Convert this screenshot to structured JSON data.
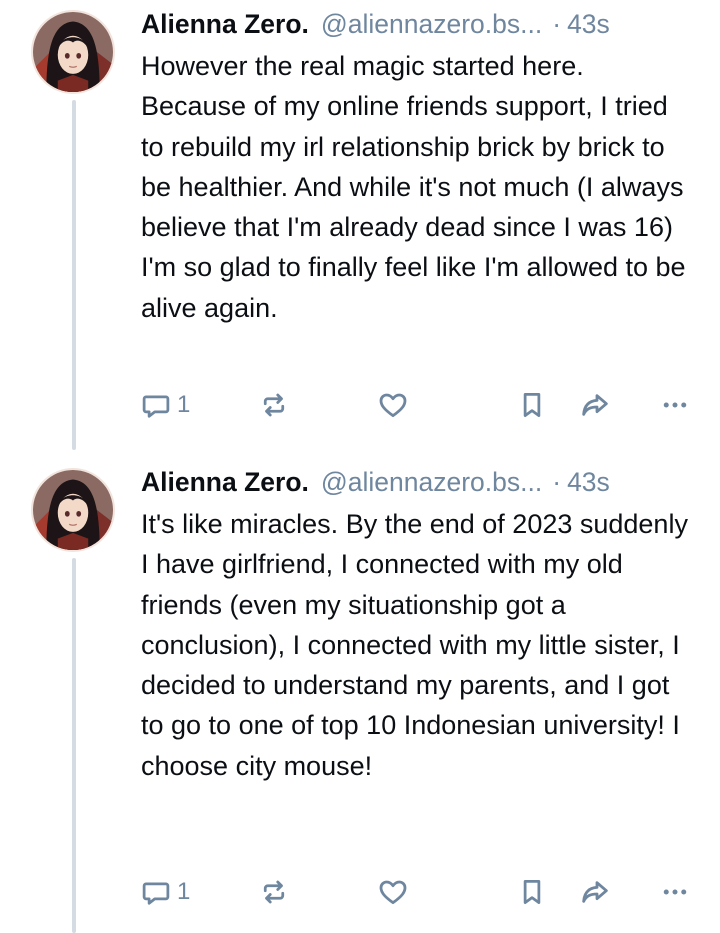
{
  "posts": [
    {
      "author_name": "Alienna Zero.",
      "handle": "@aliennazero.bs...",
      "separator": "·",
      "time": "43s",
      "text": "However the real magic started here. Because of my online friends support, I tried to rebuild my irl relationship brick by brick to be healthier. And while it's not much (I always believe that I'm already dead since I was 16) I'm so glad to finally feel like I'm allowed to be alive again.",
      "reply_count": "1",
      "icons": [
        "reply-icon",
        "repost-icon",
        "like-icon",
        "bookmark-icon",
        "share-icon",
        "more-icon"
      ]
    },
    {
      "author_name": "Alienna Zero.",
      "handle": "@aliennazero.bs...",
      "separator": "·",
      "time": "43s",
      "text": "It's like miracles. By the end of 2023 suddenly I have girlfriend, I connected with my old friends (even my situationship got a conclusion), I connected with my little sister, I decided to understand my parents, and I got to go to one of top 10 Indonesian university! I choose city mouse!",
      "reply_count": "1",
      "icons": [
        "reply-icon",
        "repost-icon",
        "like-icon",
        "bookmark-icon",
        "share-icon",
        "more-icon"
      ]
    }
  ],
  "colors": {
    "text": "#0b0f14",
    "muted": "#6f869f",
    "thread_line": "#d4dbe2"
  }
}
